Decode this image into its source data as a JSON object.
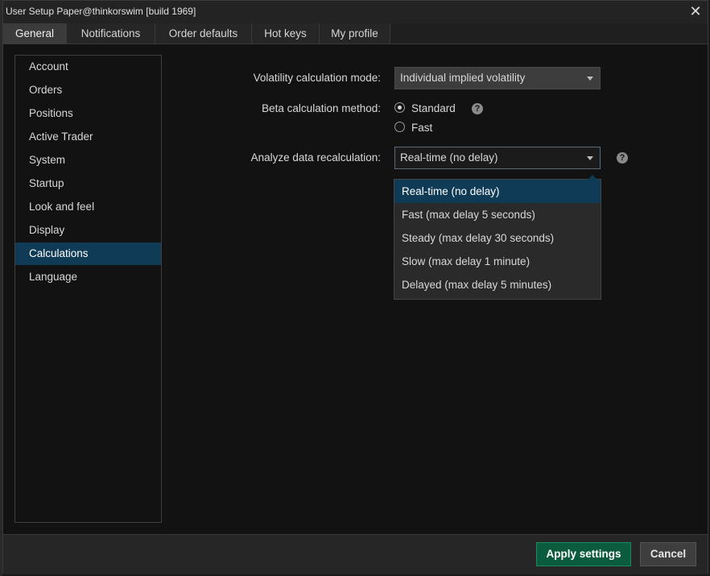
{
  "window": {
    "title": "User Setup Paper@thinkorswim [build 1969]",
    "close_symbol": "✕"
  },
  "tabs": [
    {
      "label": "General",
      "active": true
    },
    {
      "label": "Notifications",
      "active": false
    },
    {
      "label": "Order defaults",
      "active": false
    },
    {
      "label": "Hot keys",
      "active": false
    },
    {
      "label": "My profile",
      "active": false
    }
  ],
  "sidebar": {
    "items": [
      {
        "label": "Account"
      },
      {
        "label": "Orders"
      },
      {
        "label": "Positions"
      },
      {
        "label": "Active Trader"
      },
      {
        "label": "System"
      },
      {
        "label": "Startup"
      },
      {
        "label": "Look and feel"
      },
      {
        "label": "Display"
      },
      {
        "label": "Calculations",
        "active": true
      },
      {
        "label": "Language"
      }
    ]
  },
  "settings": {
    "volatility": {
      "label": "Volatility calculation mode:",
      "value": "Individual implied volatility"
    },
    "beta": {
      "label": "Beta calculation method:",
      "options": [
        {
          "label": "Standard",
          "checked": true
        },
        {
          "label": "Fast",
          "checked": false
        }
      ]
    },
    "analyze": {
      "label": "Analyze data recalculation:",
      "value": "Real-time (no delay)",
      "options": [
        "Real-time (no delay)",
        "Fast (max delay 5 seconds)",
        "Steady (max delay 30 seconds)",
        "Slow (max delay 1 minute)",
        "Delayed (max delay 5 minutes)"
      ],
      "selected_index": 0
    },
    "help_symbol": "?"
  },
  "footer": {
    "apply_label": "Apply settings",
    "cancel_label": "Cancel"
  },
  "colors": {
    "accent": "#0f3b57",
    "apply": "#0b5b3e",
    "background": "#121212"
  }
}
